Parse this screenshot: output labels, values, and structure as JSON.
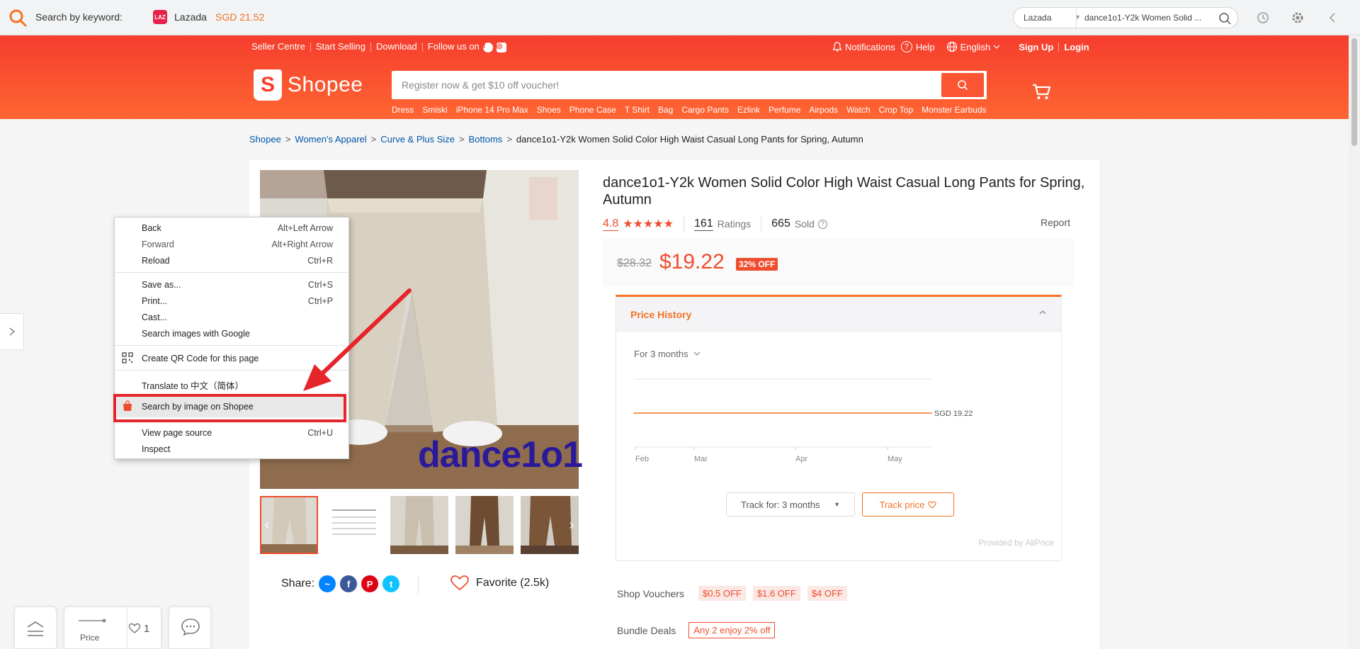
{
  "extension": {
    "search_label": "Search by keyword:",
    "lazada_name": "Lazada",
    "lazada_price": "SGD 21.52",
    "lazada_logo_text": "LAZ",
    "select_value": "Lazada",
    "input_value": "dance1o1-Y2k Women Solid ..."
  },
  "header": {
    "top_links": [
      "Seller Centre",
      "Start Selling",
      "Download",
      "Follow us on"
    ],
    "notifications": "Notifications",
    "help": "Help",
    "language": "English",
    "signup": "Sign Up",
    "login": "Login",
    "logo_text": "Shopee",
    "search_placeholder": "Register now & get $10 off voucher!",
    "hot_keywords": [
      "Dress",
      "Smiski",
      "iPhone 14 Pro Max",
      "Shoes",
      "Phone Case",
      "T Shirt",
      "Bag",
      "Cargo Pants",
      "Ezlink",
      "Perfume",
      "Airpods",
      "Watch",
      "Crop Top",
      "Monster Earbuds"
    ]
  },
  "breadcrumb": {
    "links": [
      "Shopee",
      "Women's Apparel",
      "Curve & Plus Size",
      "Bottoms"
    ],
    "current": "dance1o1-Y2k Women Solid Color High Waist Casual Long Pants for Spring, Autumn"
  },
  "product": {
    "title": "dance1o1-Y2k Women Solid Color High Waist Casual Long Pants for Spring, Autumn",
    "rating": "4.8",
    "stars": "★★★★★",
    "ratings_count": "161",
    "ratings_label": "Ratings",
    "sold_count": "665",
    "sold_label": "Sold",
    "report": "Report",
    "original_price": "$28.32",
    "current_price": "$19.22",
    "discount": "32% OFF",
    "watermark": "dance1o1",
    "share_label": "Share:",
    "favorite_label": "Favorite (2.5k)"
  },
  "price_history": {
    "title": "Price History",
    "range": "For 3 months",
    "price_label": "SGD 19.22",
    "track_select": "Track for: 3 months",
    "track_button": "Track price",
    "provider": "Provided by AliPrice",
    "line_color": "#f57224"
  },
  "chart_data": {
    "type": "line",
    "title": "",
    "x": [
      "Feb",
      "Mar",
      "Apr",
      "May"
    ],
    "series": [
      {
        "values": [
          19.22,
          19.22,
          19.22,
          19.22
        ]
      }
    ],
    "xlabel": "",
    "ylabel": ""
  },
  "vouchers": {
    "label": "Shop Vouchers",
    "items": [
      "$0.5 OFF",
      "$1.6 OFF",
      "$4 OFF"
    ]
  },
  "bundle": {
    "label": "Bundle Deals",
    "tag": "Any 2 enjoy 2% off"
  },
  "floating": {
    "price_label": "Price",
    "fav_count": "1"
  },
  "context_menu": {
    "items": [
      {
        "label": "Back",
        "shortcut": "Alt+Left Arrow"
      },
      {
        "label": "Forward",
        "shortcut": "Alt+Right Arrow"
      },
      {
        "label": "Reload",
        "shortcut": "Ctrl+R"
      },
      {
        "label": "Save as...",
        "shortcut": "Ctrl+S"
      },
      {
        "label": "Print...",
        "shortcut": "Ctrl+P"
      },
      {
        "label": "Cast...",
        "shortcut": ""
      },
      {
        "label": "Search images with Google",
        "shortcut": ""
      },
      {
        "label": "Create QR Code for this page",
        "shortcut": ""
      },
      {
        "label": "Translate to 中文（简体）",
        "shortcut": ""
      },
      {
        "label": "Search by image on Shopee",
        "shortcut": ""
      },
      {
        "label": "View page source",
        "shortcut": "Ctrl+U"
      },
      {
        "label": "Inspect",
        "shortcut": ""
      }
    ]
  },
  "colors": {
    "shopee_orange": "#ee4d2d",
    "aliprice_orange": "#f57224",
    "annotation_red": "#e5252a"
  }
}
